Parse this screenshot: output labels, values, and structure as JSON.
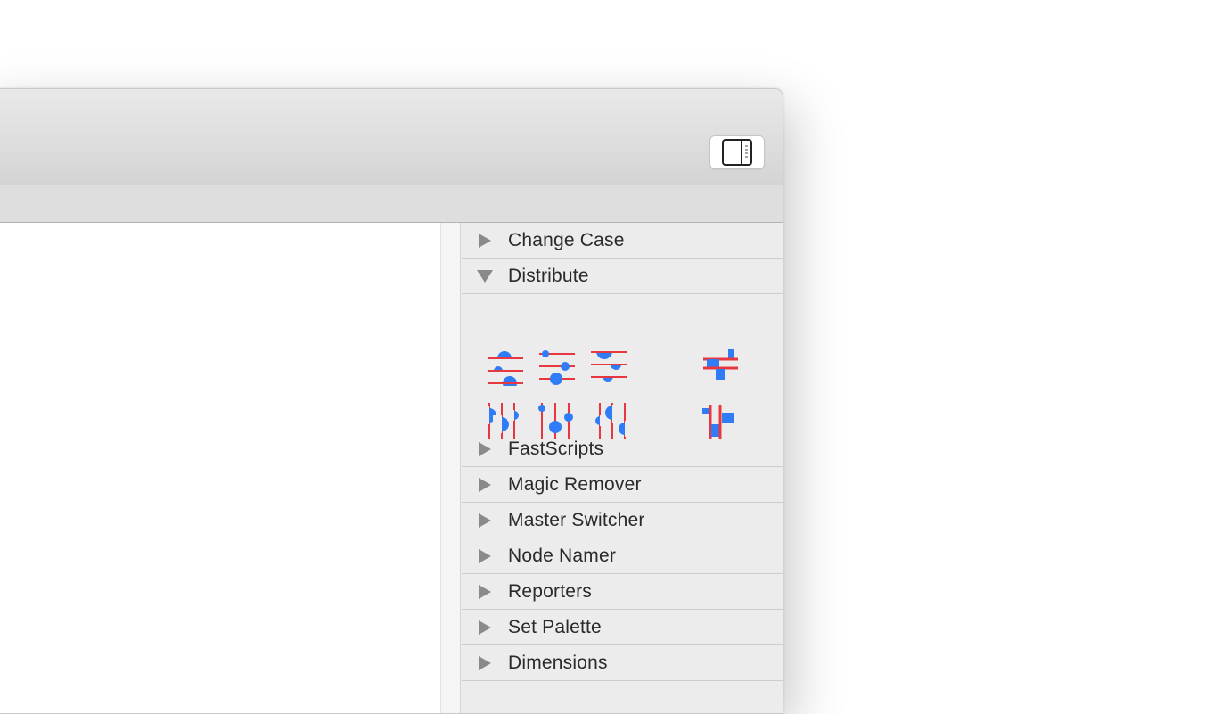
{
  "toolbar": {
    "sidebar_toggle_icon": "sidebar-right-icon"
  },
  "panel": {
    "sections": [
      {
        "label": "Change Case",
        "expanded": false
      },
      {
        "label": "Distribute",
        "expanded": true
      },
      {
        "label": "FastScripts",
        "expanded": false
      },
      {
        "label": "Magic Remover",
        "expanded": false
      },
      {
        "label": "Master Switcher",
        "expanded": false
      },
      {
        "label": "Node Namer",
        "expanded": false
      },
      {
        "label": "Reporters",
        "expanded": false
      },
      {
        "label": "Set Palette",
        "expanded": false
      },
      {
        "label": "Dimensions",
        "expanded": false
      }
    ],
    "distribute_tools": [
      "distribute-vertical-tops-icon",
      "distribute-vertical-centers-icon",
      "distribute-vertical-bottoms-icon",
      "distribute-vertical-spacing-icon",
      "distribute-horizontal-lefts-icon",
      "distribute-horizontal-centers-icon",
      "distribute-horizontal-rights-icon",
      "distribute-horizontal-spacing-icon"
    ]
  },
  "colors": {
    "guide_red": "#e8373e",
    "shape_blue": "#2f7cf6",
    "triangle_gray": "#8a8a8a"
  }
}
